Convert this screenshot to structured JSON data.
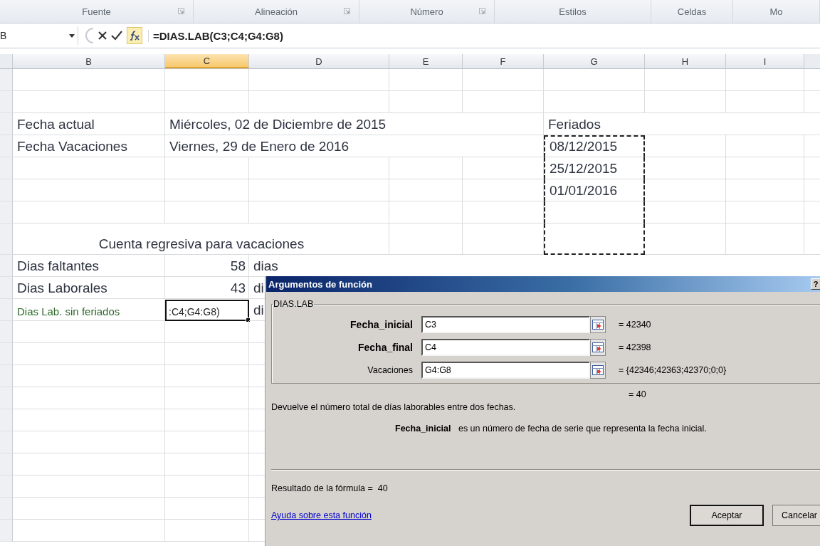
{
  "ribbon_groups": [
    {
      "label": "Fuente",
      "launcher": true
    },
    {
      "label": "Alineación",
      "launcher": true
    },
    {
      "label": "Número",
      "launcher": true
    },
    {
      "label": "Estilos",
      "launcher": false
    },
    {
      "label": "Celdas",
      "launcher": false
    },
    {
      "label": "Mo",
      "launcher": false
    }
  ],
  "formula_bar": {
    "name_box": "B",
    "formula": "=DIAS.LAB(C3;C4;G4:G8)"
  },
  "columns": [
    {
      "label": "B",
      "selected": false
    },
    {
      "label": "C",
      "selected": true
    },
    {
      "label": "D",
      "selected": false
    },
    {
      "label": "E",
      "selected": false
    },
    {
      "label": "F",
      "selected": false
    },
    {
      "label": "G",
      "selected": false
    },
    {
      "label": "H",
      "selected": false
    },
    {
      "label": "I",
      "selected": false
    }
  ],
  "rows": [
    {},
    {},
    {
      "b": {
        "text": "Fecha actual",
        "kind": "text"
      },
      "c": {
        "text": "Miércoles, 02 de Diciembre de 2015",
        "kind": "text"
      },
      "g": {
        "text": "Feriados",
        "kind": "text"
      }
    },
    {
      "b": {
        "text": "Fecha Vacaciones",
        "kind": "text"
      },
      "c": {
        "text": "Viernes, 29 de Enero de 2016",
        "kind": "text"
      },
      "g": {
        "text": "08/12/2015",
        "kind": "text",
        "marquee": true
      }
    },
    {
      "g": {
        "text": "25/12/2015",
        "kind": "text",
        "marquee": true
      }
    },
    {
      "g": {
        "text": "01/01/2016",
        "kind": "text",
        "marquee": true
      }
    },
    {
      "g": {
        "marquee": true
      }
    },
    {
      "b": {
        "text": "Cuenta regresiva para vacaciones",
        "kind": "merged"
      },
      "g": {
        "marquee": true
      }
    },
    {
      "b": {
        "text": "Dias faltantes",
        "kind": "text"
      },
      "c": {
        "text": "58",
        "kind": "number"
      },
      "d": {
        "text": "dias",
        "kind": "text"
      }
    },
    {
      "b": {
        "text": "Dias Laborales",
        "kind": "text"
      },
      "c": {
        "text": "43",
        "kind": "number"
      },
      "d": {
        "text": "di",
        "kind": "text"
      }
    },
    {
      "b": {
        "text": "Dias Lab. sin feriados",
        "kind": "small"
      },
      "c": {
        "text": ":C4;G4:G8)",
        "kind": "text",
        "active": true
      },
      "d": {
        "text": "di",
        "kind": "text"
      }
    }
  ],
  "dialog": {
    "title": "Argumentos de función",
    "help_button": "?",
    "function_name": "DIAS.LAB",
    "arguments": [
      {
        "label": "Fecha_inicial",
        "required": true,
        "value": "C3",
        "result": "= 42340"
      },
      {
        "label": "Fecha_final",
        "required": true,
        "value": "C4",
        "result": "= 42398"
      },
      {
        "label": "Vacaciones",
        "required": false,
        "value": "G4:G8",
        "result": "= {42346;42363;42370;0;0}"
      }
    ],
    "formula_result": "= 40",
    "description": "Devuelve el número total de días laborables entre dos fechas.",
    "argument_help": "**Fecha_inicial**   es un número de fecha de serie que representa la fecha inicial.",
    "result_line": "Resultado de la fórmula =  40",
    "help_link": "Ayuda sobre esta función",
    "buttons": [
      {
        "label": "Aceptar",
        "default": true
      },
      {
        "label": "Cancelar",
        "default": false
      }
    ]
  }
}
